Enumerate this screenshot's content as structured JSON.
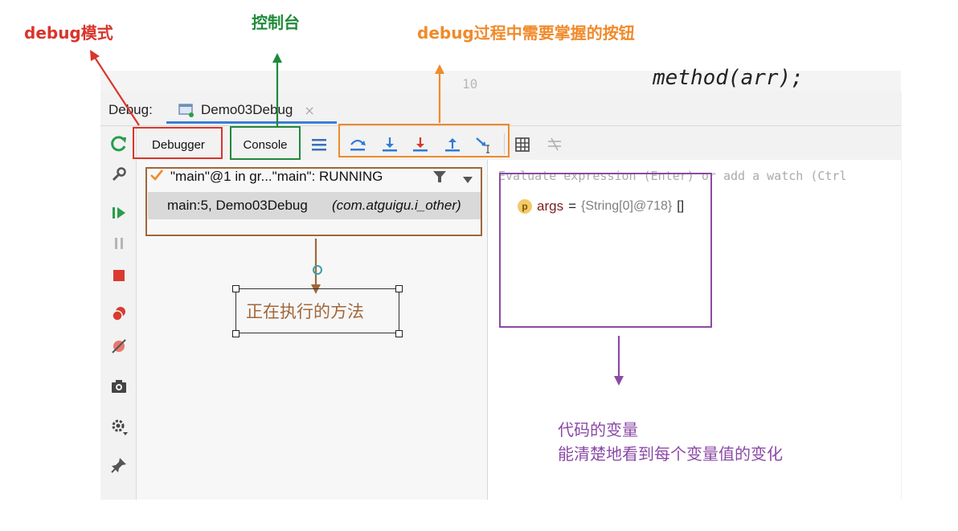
{
  "editor": {
    "line_number": "10",
    "code_fragment": "method(arr);"
  },
  "debug_panel": {
    "label": "Debug:",
    "tab_title": "Demo03Debug",
    "tab_close": "×",
    "toolbar": {
      "debugger_tab": "Debugger",
      "console_tab": "Console"
    },
    "frames": {
      "thread_row": "\"main\"@1 in gr...\"main\": RUNNING",
      "frame_main": "main:5, Demo03Debug",
      "frame_package": "(com.atguigu.i_other)"
    },
    "variables": {
      "evaluate_placeholder": "Evaluate expression (Enter) or add a watch (Ctrl",
      "var_badge": "p",
      "var_name": "args",
      "var_eq": "=",
      "var_value": "{String[0]@718}",
      "var_brackets": "[]"
    }
  },
  "annotations": {
    "debug_mode": "debug模式",
    "console": "控制台",
    "buttons": "debug过程中需要掌握的按钮",
    "executing_method": "正在执行的方法",
    "variables_line1": "代码的变量",
    "variables_line2": "能清楚地看到每个变量值的变化"
  },
  "colors": {
    "red": "#d9352b",
    "green": "#1f8a3a",
    "orange": "#f08a2a",
    "brown": "#a0673a",
    "purple": "#8b4aa6",
    "accent_blue": "#3b7dd8"
  },
  "icons": [
    "rerun-icon",
    "settings-wrench-icon",
    "resume-icon",
    "pause-icon",
    "stop-icon",
    "view-breakpoints-icon",
    "mute-breakpoints-icon",
    "camera-icon",
    "gear-icon",
    "pin-icon",
    "layout-icon",
    "step-over-icon",
    "step-into-icon",
    "force-step-into-icon",
    "step-out-icon",
    "run-to-cursor-icon",
    "evaluate-icon",
    "trace-icon",
    "filter-icon",
    "dropdown-icon",
    "check-icon"
  ]
}
